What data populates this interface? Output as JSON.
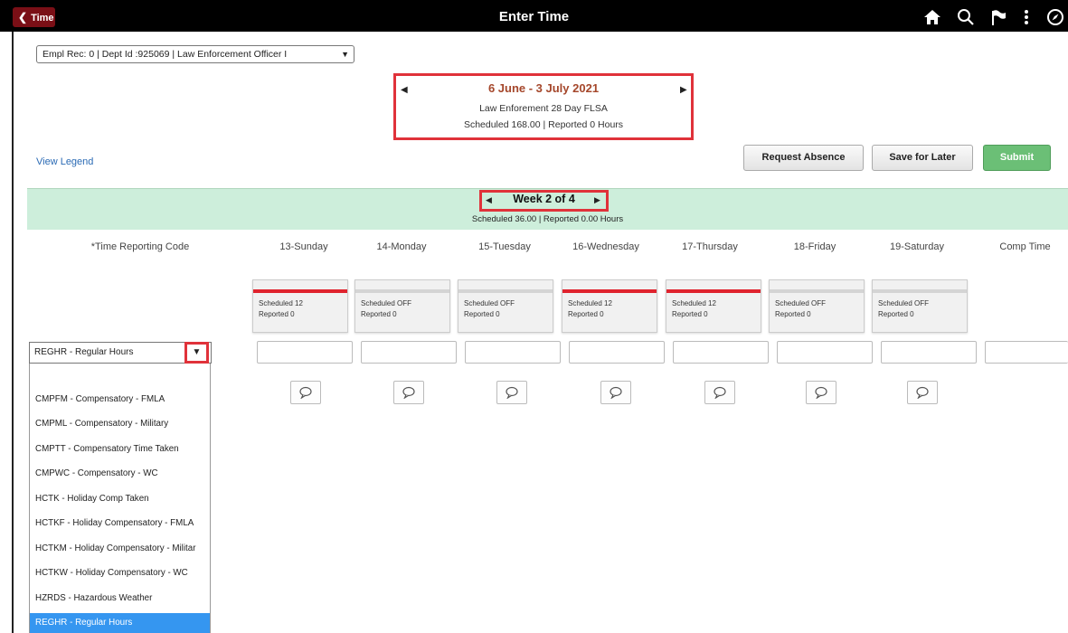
{
  "header": {
    "back_label": "Time",
    "title": "Enter Time",
    "icons": [
      "home-icon",
      "search-icon",
      "flag-icon",
      "more-vertical-icon",
      "compass-icon"
    ]
  },
  "employment": {
    "selected": "Empl Rec: 0 | Dept Id :925069 | Law Enforcement Officer I"
  },
  "period": {
    "title": "6 June - 3 July 2021",
    "schedule_name": "Law Enforement 28 Day FLSA",
    "summary": "Scheduled  168.00 | Reported  0 Hours"
  },
  "view_legend": "View Legend",
  "actions": {
    "request_absence": "Request Absence",
    "save_for_later": "Save for Later",
    "submit": "Submit"
  },
  "week": {
    "label": "Week 2 of 4",
    "summary": "Scheduled  36.00 | Reported  0.00 Hours"
  },
  "columns": {
    "trc_header": "*Time Reporting Code",
    "days": [
      "13-Sunday",
      "14-Monday",
      "15-Tuesday",
      "16-Wednesday",
      "17-Thursday",
      "18-Friday",
      "19-Saturday"
    ],
    "comp_time": "Comp Time"
  },
  "day_cards": [
    {
      "scheduled": "Scheduled 12",
      "reported": "Reported  0",
      "bar_color": "#e0232e"
    },
    {
      "scheduled": "Scheduled OFF",
      "reported": "Reported  0",
      "bar_color": "#d4d4d4"
    },
    {
      "scheduled": "Scheduled OFF",
      "reported": "Reported  0",
      "bar_color": "#d4d4d4"
    },
    {
      "scheduled": "Scheduled 12",
      "reported": "Reported  0",
      "bar_color": "#e0232e"
    },
    {
      "scheduled": "Scheduled 12",
      "reported": "Reported  0",
      "bar_color": "#e0232e"
    },
    {
      "scheduled": "Scheduled OFF",
      "reported": "Reported  0",
      "bar_color": "#d4d4d4"
    },
    {
      "scheduled": "Scheduled OFF",
      "reported": "Reported  0",
      "bar_color": "#d4d4d4"
    }
  ],
  "trc": {
    "selected": "REGHR - Regular Hours",
    "options": [
      "",
      "CMPFM - Compensatory - FMLA",
      "CMPML - Compensatory - Military",
      "CMPTT - Compensatory Time Taken",
      "CMPWC - Compensatory - WC",
      "HCTK - Holiday Comp Taken",
      "HCTKF - Holiday Compensatory - FMLA",
      "HCTKM - Holiday Compensatory - Militar",
      "HCTKW - Holiday Compensatory - WC",
      "HZRDS - Hazardous Weather",
      "REGHR - Regular Hours"
    ]
  },
  "colors": {
    "header_bg": "#000000",
    "back_button": "#7a0f16",
    "period_title": "#a5472b",
    "highlight_box": "#e0323a",
    "week_band": "#cdeedb",
    "submit": "#6bbf76",
    "selected_option": "#3596f0",
    "link": "#2a6ab4"
  }
}
